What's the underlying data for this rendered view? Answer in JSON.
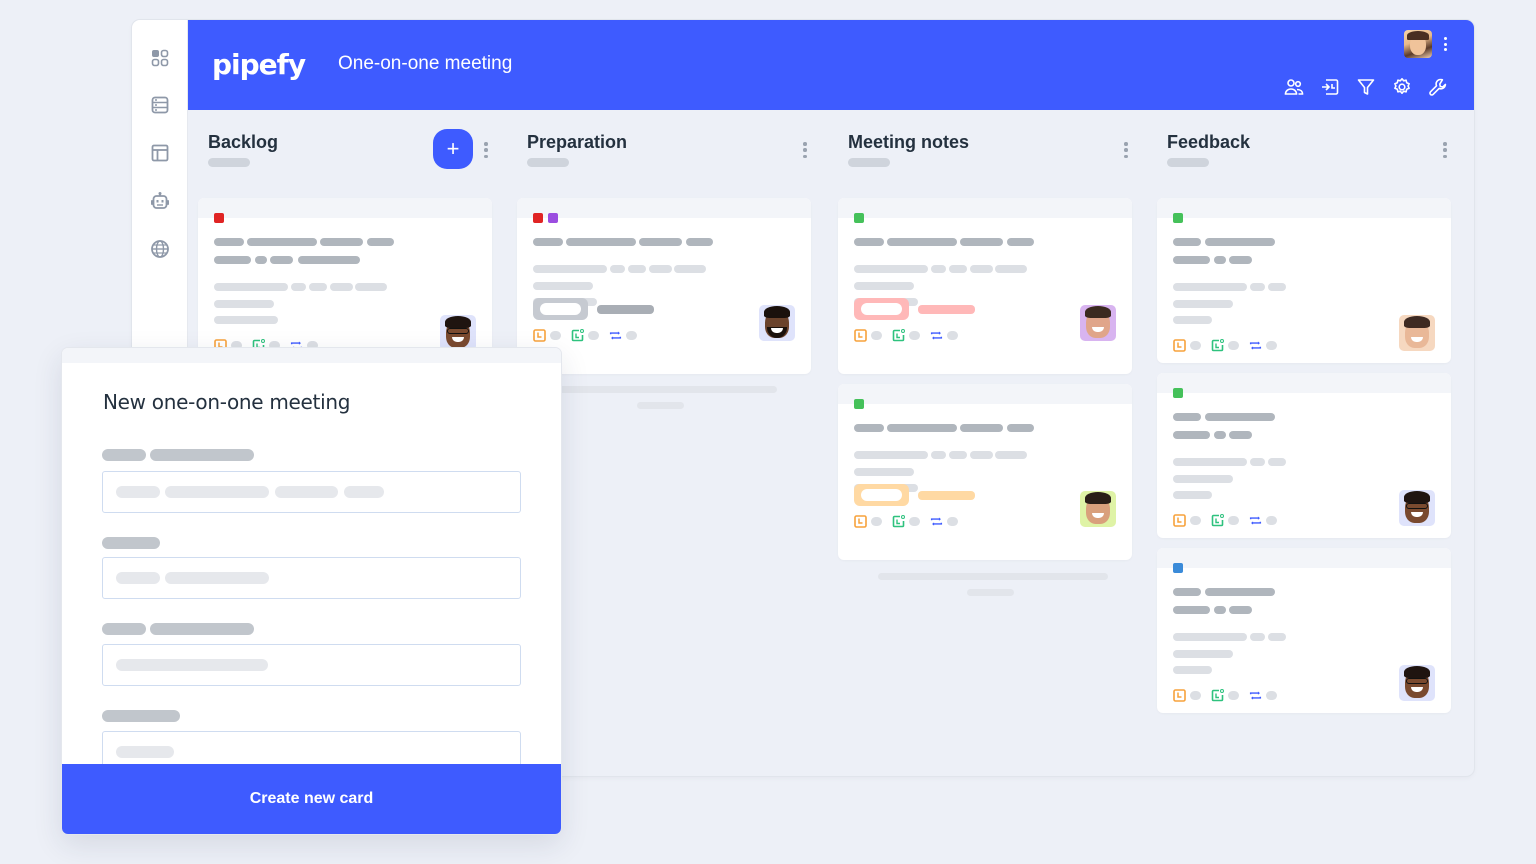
{
  "header": {
    "logo": "pipefy",
    "pipe_title": "One-on-one meeting",
    "toolbar_icons": [
      "members-icon",
      "import-icon",
      "filter-icon",
      "settings-icon",
      "wrench-icon"
    ]
  },
  "sidebar": {
    "items": [
      {
        "icon": "apps-grid-icon"
      },
      {
        "icon": "database-icon"
      },
      {
        "icon": "layout-icon"
      },
      {
        "icon": "robot-icon"
      },
      {
        "icon": "globe-icon"
      }
    ]
  },
  "colors": {
    "brand_blue": "#3e5bff",
    "label_red": "#e02424",
    "label_purple": "#9b4de0",
    "label_green": "#45c15a",
    "label_blue": "#3b8bd9",
    "chip_red": "#ffb8b8",
    "chip_orange": "#ffd9a3",
    "chip_gray": "#c6cad1",
    "icon_orange": "#f7a23b",
    "icon_green": "#2ec27e",
    "icon_blue": "#3e5bff"
  },
  "columns": [
    {
      "title": "Backlog",
      "has_add_button": true,
      "add_label": "+",
      "cards": [
        {
          "labels": [
            "red"
          ],
          "chip": null,
          "avatar": "person-glasses"
        }
      ]
    },
    {
      "title": "Preparation",
      "has_add_button": false,
      "cards": [
        {
          "labels": [
            "red",
            "purple"
          ],
          "chip": "gray",
          "avatar": "person-beard"
        }
      ]
    },
    {
      "title": "Meeting notes",
      "has_add_button": false,
      "cards": [
        {
          "labels": [
            "green"
          ],
          "chip": "red",
          "avatar": "person-smiling-man"
        },
        {
          "labels": [
            "green"
          ],
          "chip": "orange",
          "avatar": "person-man-green-bg"
        }
      ]
    },
    {
      "title": "Feedback",
      "has_add_button": false,
      "cards": [
        {
          "labels": [
            "green"
          ],
          "chip": null,
          "avatar": "person-woman"
        },
        {
          "labels": [
            "green"
          ],
          "chip": null,
          "avatar": "person-glasses"
        },
        {
          "labels": [
            "blue"
          ],
          "chip": null,
          "avatar": "person-glasses"
        }
      ]
    }
  ],
  "modal": {
    "title": "New one-on-one meeting",
    "fields": 4,
    "submit_label": "Create new card"
  }
}
